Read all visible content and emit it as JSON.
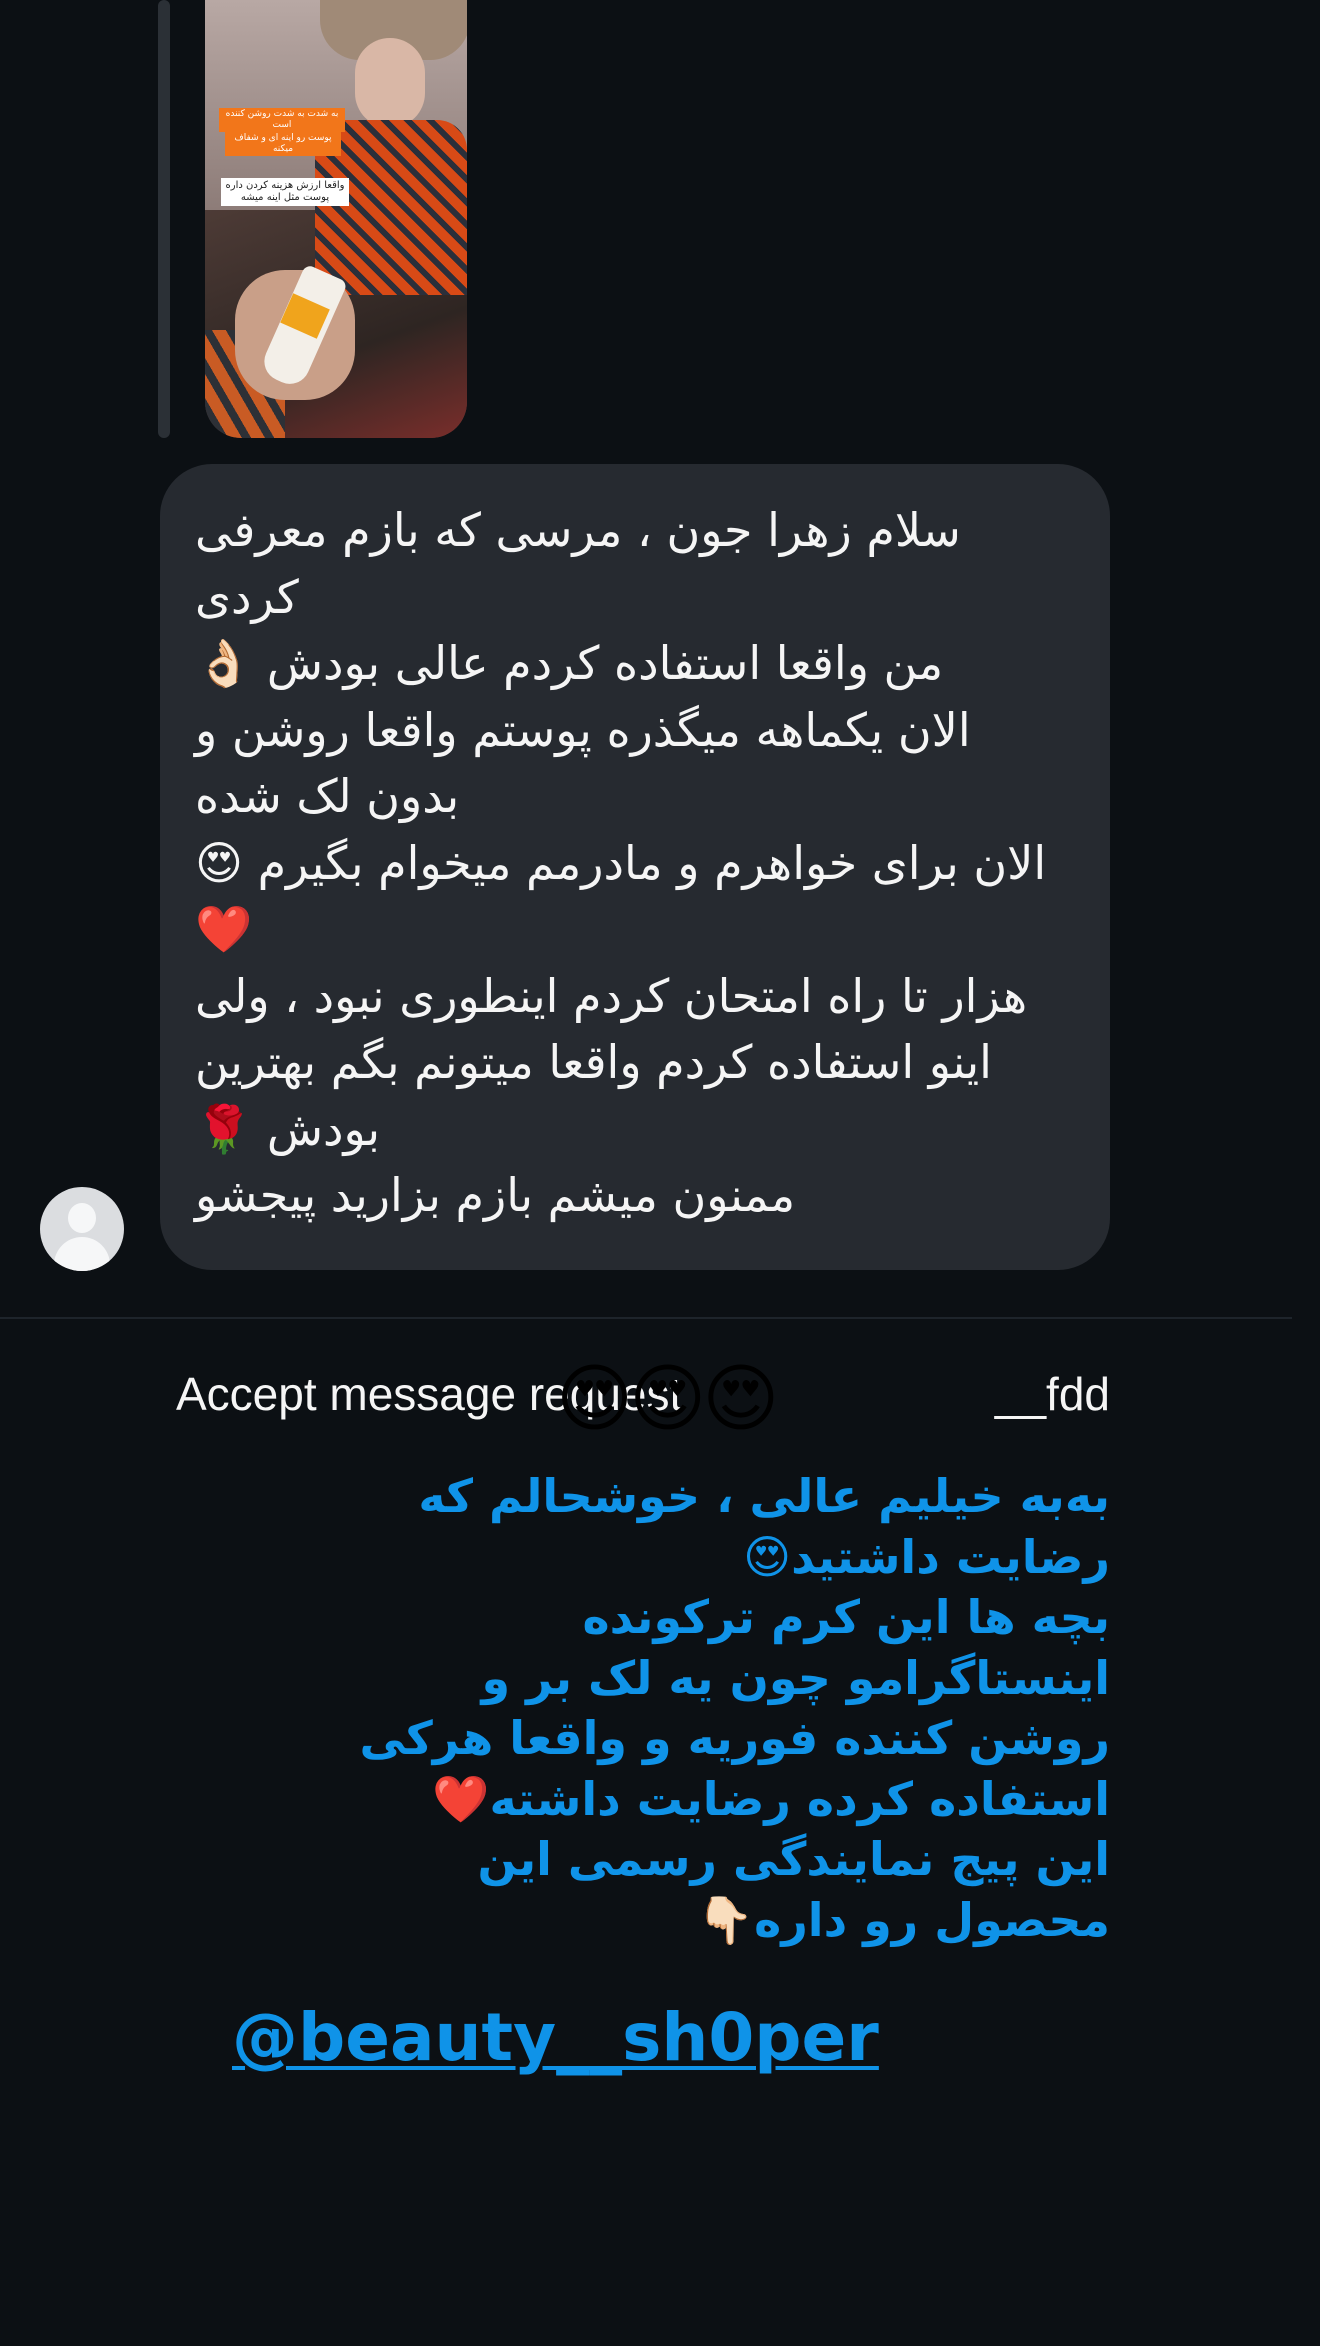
{
  "story_reply": {
    "overlay_tags": [
      "به شدت به شدت روشن کننده است",
      "پوست رو اینه ای و شفاف میکنه",
      "واقعا ارزش هزینه کردن داره پوست مثل اینه میشه"
    ]
  },
  "incoming_message": {
    "text": "سلام زهرا جون ، مرسی که بازم معرفی کردی\nمن واقعا استفاده کردم عالی بودش 👌🏻\nالان یکماهه میگذره پوستم واقعا روشن و بدون لک شده\nالان برای خواهرم و مادرمم میخوام بگیرم 😍❤️\nهزار تا راه امتحان کردم اینطوری نبود ، ولی اینو استفاده کردم واقعا میتونم بگم بهترین بودش 🌹\nممنون میشم بازم بزارید پیجشو"
  },
  "accept_request": {
    "label": "Accept message request",
    "partial_suffix": "__fdd",
    "emojis": "😍😍😍"
  },
  "reply_message": {
    "text": "به‌به خیلیم عالی ، خوشحالم که رضایت داشتید😍\nبچه ها این کرم ترکونده اینستاگرامو چون یه لک بر و روشن کننده فوریه و واقعا هرکی استفاده کرده رضایت داشته❤️\nاین پیج نمایندگی رسمی این محصول رو داره👇🏻"
  },
  "handle": {
    "text": "@beauty__sh0per"
  }
}
